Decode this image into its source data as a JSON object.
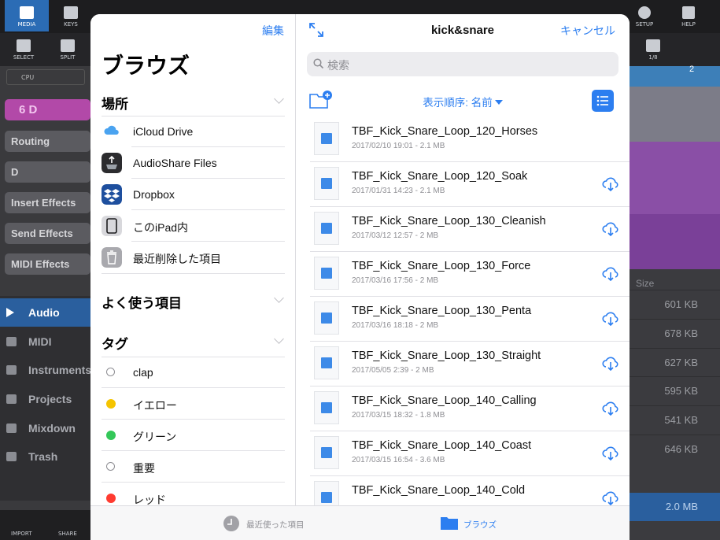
{
  "background": {
    "toolbar_top": [
      {
        "label": "MEDIA",
        "active": true
      },
      {
        "label": "KEYS",
        "active": false
      }
    ],
    "toolbar_top_right": [
      "SETUP",
      "HELP"
    ],
    "toolbar_row2": [
      "SELECT",
      "SPLIT"
    ],
    "snap_label": "1/8",
    "ruler_number": "2",
    "cpu_label": "CPU",
    "tracks": [
      "6 D",
      "Routing",
      "D",
      "Insert Effects",
      "Send Effects",
      "MIDI Effects"
    ],
    "nav": [
      "Audio",
      "MIDI",
      "Instruments",
      "Projects",
      "Mixdown",
      "Trash"
    ],
    "bottom_buttons": [
      "IMPORT",
      "SHARE"
    ],
    "size_header": "Size",
    "sizes": [
      "601 KB",
      "678 KB",
      "627 KB",
      "595 KB",
      "541 KB",
      "646 KB"
    ],
    "selected_size": "2.0 MB"
  },
  "browser": {
    "edit_label": "編集",
    "title": "ブラウズ",
    "locations_header": "場所",
    "locations": [
      {
        "label": "iCloud Drive",
        "icon": "icloud-icon"
      },
      {
        "label": "AudioShare Files",
        "icon": "audioshare-icon"
      },
      {
        "label": "Dropbox",
        "icon": "dropbox-icon"
      },
      {
        "label": "このiPad内",
        "icon": "ipad-icon"
      },
      {
        "label": "最近削除した項目",
        "icon": "trash-icon"
      }
    ],
    "favorites_header": "よく使う項目",
    "tags_header": "タグ",
    "tags": [
      {
        "label": "clap",
        "color": ""
      },
      {
        "label": "イエロー",
        "color": "#f5c400"
      },
      {
        "label": "グリーン",
        "color": "#34c759"
      },
      {
        "label": "重要",
        "color": ""
      },
      {
        "label": "レッド",
        "color": "#ff3b30"
      }
    ]
  },
  "main": {
    "folder_title": "kick&snare",
    "cancel_label": "キャンセル",
    "search_placeholder": "検索",
    "sort_label": "表示順序: 名前",
    "files": [
      {
        "name": "TBF_Kick_Snare_Loop_120_Horses",
        "meta": "2017/02/10 19:01 - 2.1 MB",
        "cloud": false
      },
      {
        "name": "TBF_Kick_Snare_Loop_120_Soak",
        "meta": "2017/01/31 14:23 - 2.1 MB",
        "cloud": true
      },
      {
        "name": "TBF_Kick_Snare_Loop_130_Cleanish",
        "meta": "2017/03/12 12:57 - 2 MB",
        "cloud": true
      },
      {
        "name": "TBF_Kick_Snare_Loop_130_Force",
        "meta": "2017/03/16 17:56 - 2 MB",
        "cloud": true
      },
      {
        "name": "TBF_Kick_Snare_Loop_130_Penta",
        "meta": "2017/03/16 18:18 - 2 MB",
        "cloud": true
      },
      {
        "name": "TBF_Kick_Snare_Loop_130_Straight",
        "meta": "2017/05/05 2:39 - 2 MB",
        "cloud": true
      },
      {
        "name": "TBF_Kick_Snare_Loop_140_Calling",
        "meta": "2017/03/15 18:32 - 1.8 MB",
        "cloud": true
      },
      {
        "name": "TBF_Kick_Snare_Loop_140_Coast",
        "meta": "2017/03/15 16:54 - 3.6 MB",
        "cloud": true
      },
      {
        "name": "TBF_Kick_Snare_Loop_140_Cold",
        "meta": "",
        "cloud": true
      }
    ]
  },
  "tabbar": {
    "recents_label": "最近使った項目",
    "browse_label": "ブラウズ",
    "active": "browse"
  },
  "colors": {
    "accent": "#2c7ef0",
    "daw_blue": "#2b6cb5",
    "track_purple": "#8a4fa6"
  }
}
